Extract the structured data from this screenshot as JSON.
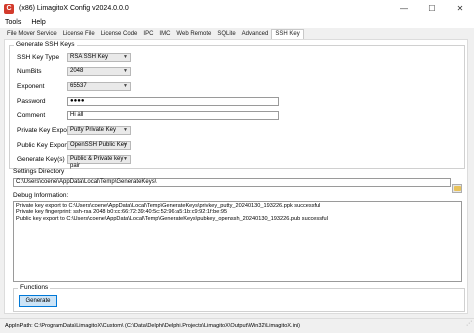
{
  "window": {
    "icon_text": "C",
    "title": "(x86) LimagitoX Config v2024.0.0.0",
    "minimize": "—",
    "maximize": "☐",
    "close": "✕"
  },
  "menu": [
    "Tools",
    "Help"
  ],
  "tabs": [
    "File Mover Service",
    "License File",
    "License Code",
    "IPC",
    "IMC",
    "Web Remote",
    "SQLite",
    "Advanced",
    "SSH Key"
  ],
  "generate_group": {
    "title": "Generate SSH Keys",
    "ssh_key_type": {
      "label": "SSH Key Type",
      "value": "RSA SSH Key"
    },
    "num_bits": {
      "label": "NumBits",
      "value": "2048"
    },
    "exponent": {
      "label": "Exponent",
      "value": "65537"
    },
    "password": {
      "label": "Password",
      "value": "●●●●"
    },
    "comment": {
      "label": "Comment",
      "value": "Hi all"
    },
    "private_key_export": {
      "label": "Private Key Export",
      "value": "Putty Private Key"
    },
    "public_key_export": {
      "label": "Public Key Export",
      "value": "OpenSSH Public Key"
    },
    "generate_keys": {
      "label": "Generate Key(s)",
      "value": "Public & Private key pair"
    }
  },
  "settings_directory": {
    "label": "Settings Directory",
    "value": "C:\\Users\\coene\\AppData\\Local\\Temp\\GenerateKeys\\"
  },
  "debug": {
    "label": "Debug Information:",
    "lines": [
      "Private key export to C:\\Users\\coene\\AppData\\Local\\Temp\\GenerateKeys\\privkey_putty_20240130_193226.ppk successful",
      "Private key fingerprint: ssh-rsa 2048 b0:cc:66:72:39:40:5c:52:96:a5:1b:c9:92:1f:be:95",
      "Public key export to C:\\Users\\coene\\AppData\\Local\\Temp\\GenerateKeys\\pubkey_openssh_20240130_193226.pub successful"
    ]
  },
  "functions": {
    "title": "Functions",
    "generate_button": "Generate"
  },
  "status": "AppInPath: C:\\ProgramData\\LimagitoX\\Custom\\ (C:\\Data\\Delphi\\Delphi.Projects\\LimagitoX\\Output\\Win32\\LimagitoX.ini)"
}
